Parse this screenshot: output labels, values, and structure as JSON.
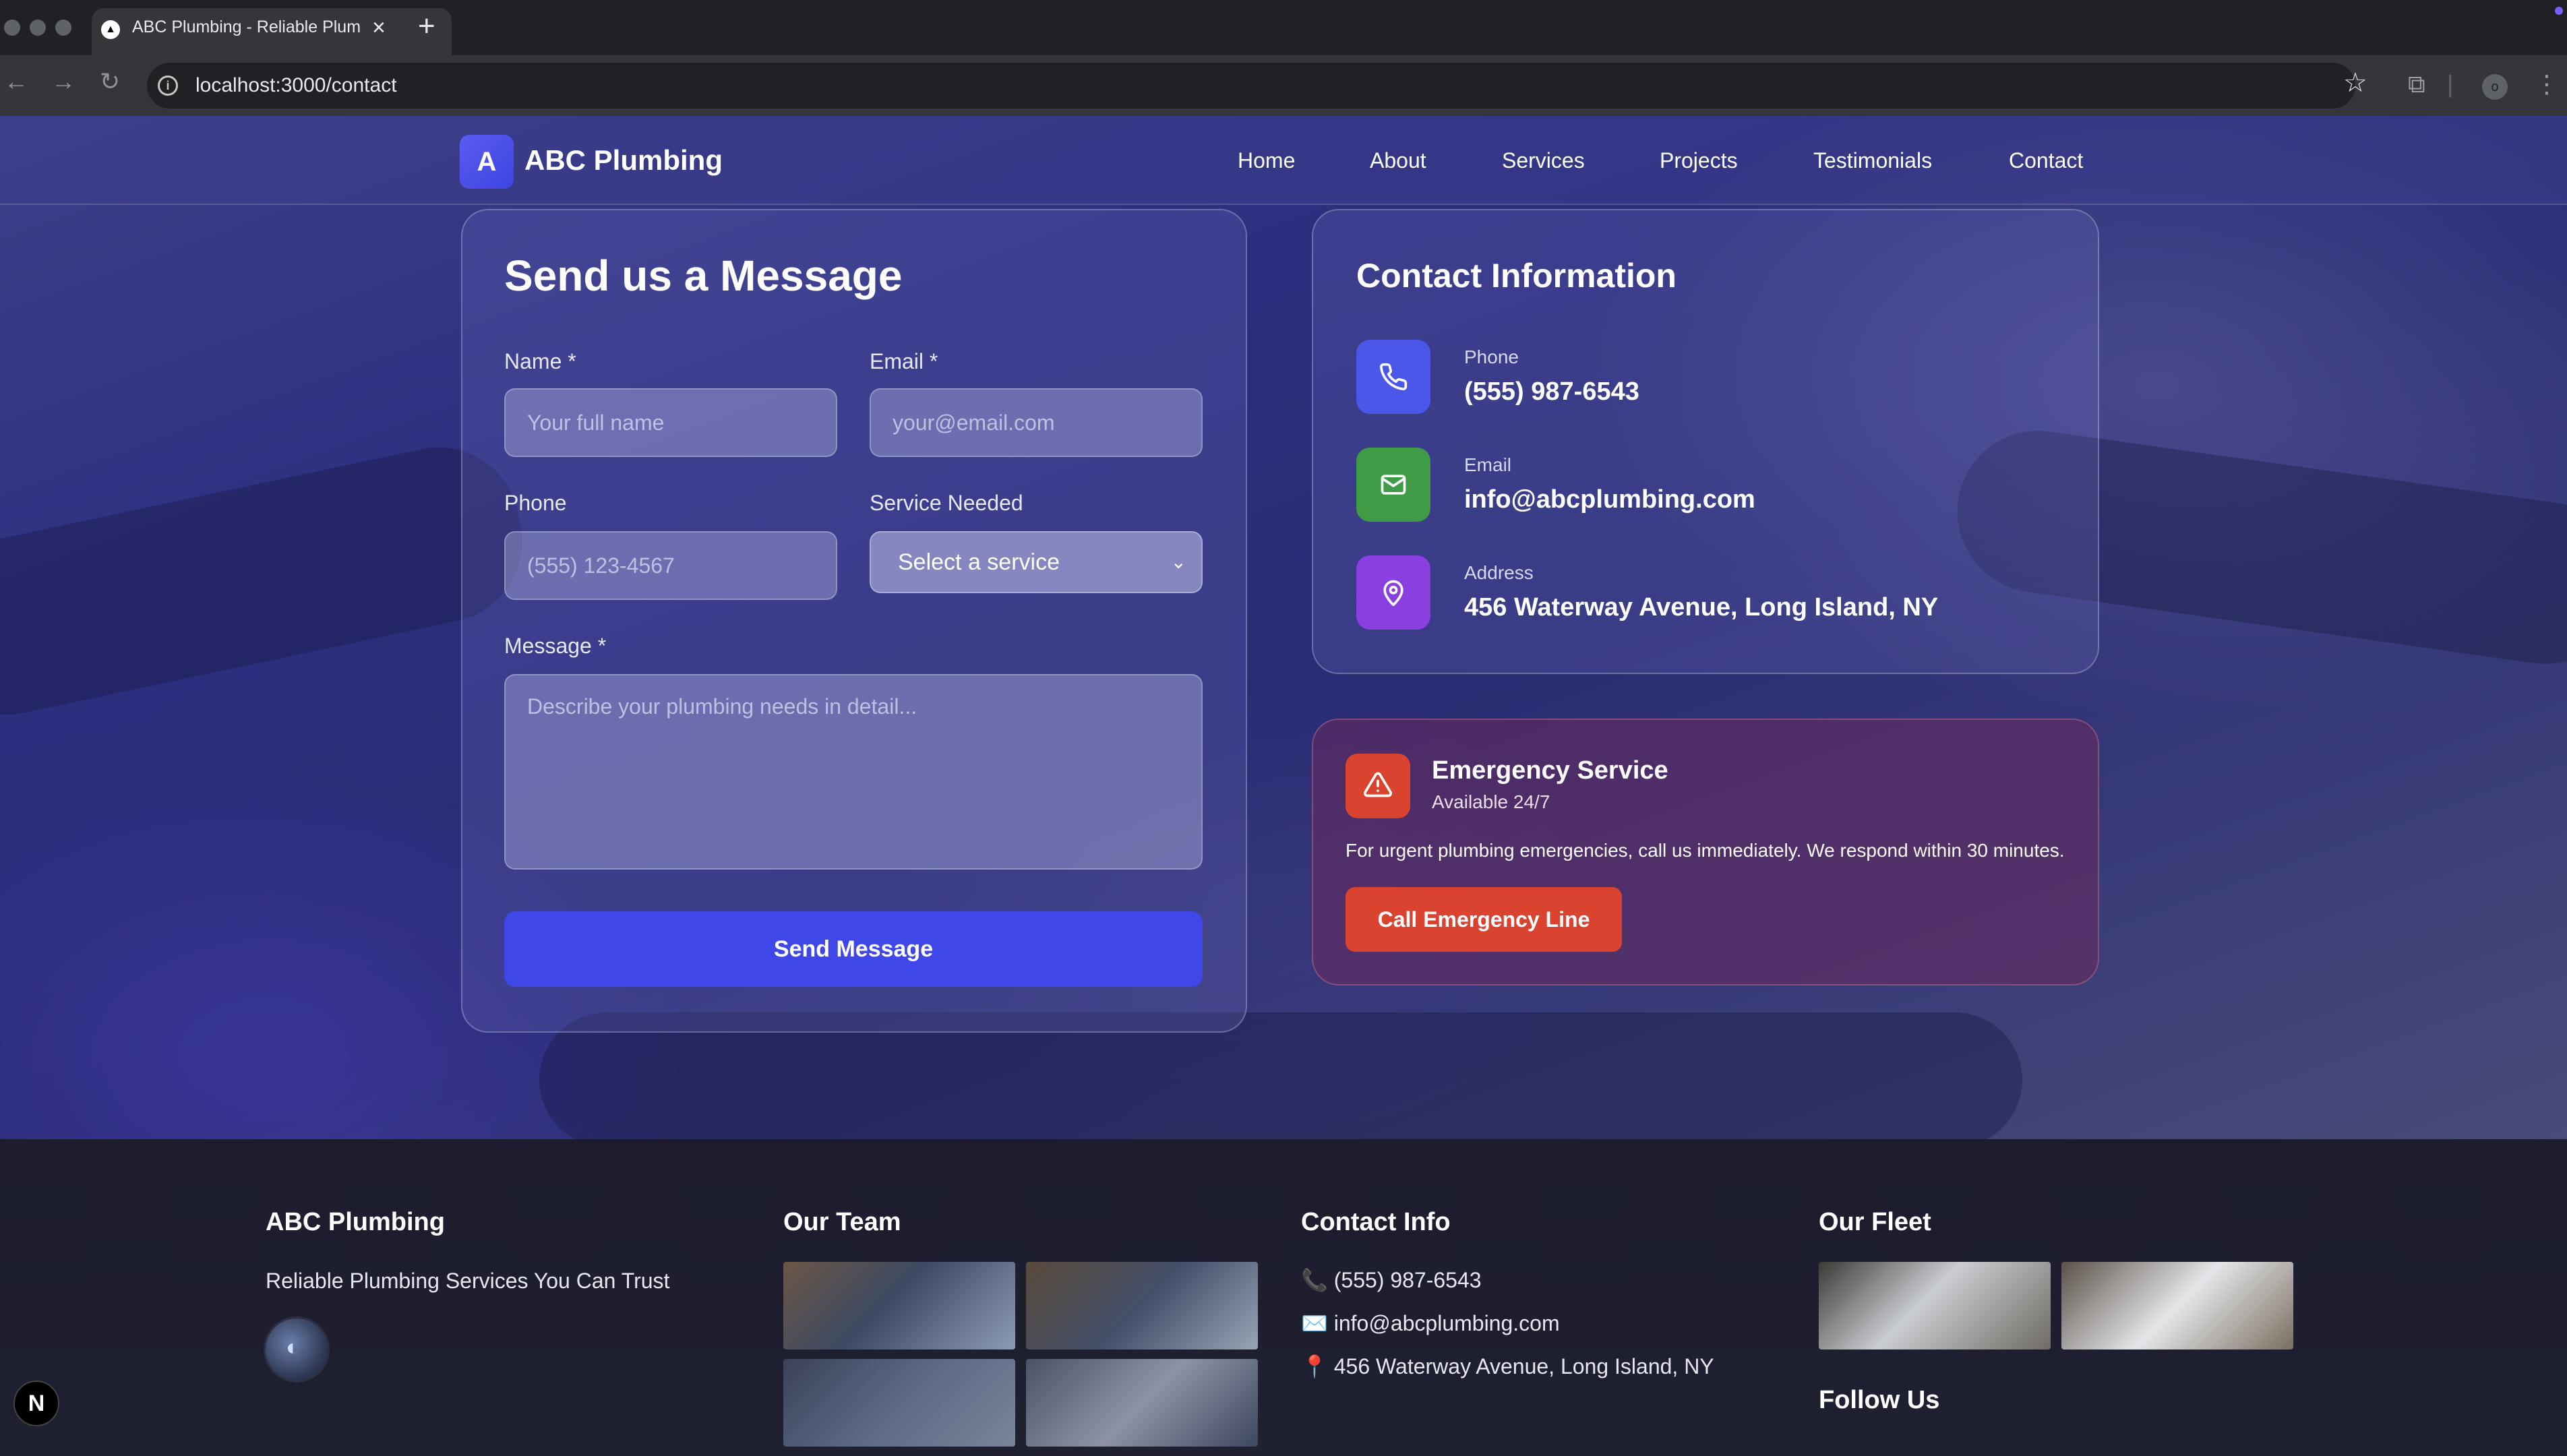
{
  "browser": {
    "tab_title": "ABC Plumbing - Reliable Plumbing Services",
    "url": "localhost:3000/contact"
  },
  "site": {
    "logo_letter": "A",
    "logo_text": "ABC Plumbing",
    "nav": [
      "Home",
      "About",
      "Services",
      "Projects",
      "Testimonials",
      "Contact"
    ]
  },
  "form": {
    "title": "Send us a Message",
    "name_label": "Name *",
    "name_placeholder": "Your full name",
    "email_label": "Email *",
    "email_placeholder": "your@email.com",
    "phone_label": "Phone",
    "phone_placeholder": "(555) 123-4567",
    "service_label": "Service Needed",
    "service_value": "Select a service",
    "message_label": "Message *",
    "message_placeholder": "Describe your plumbing needs in detail...",
    "submit_label": "Send Message"
  },
  "contact_info": {
    "title": "Contact Information",
    "phone_label": "Phone",
    "phone_value": "(555) 987-6543",
    "email_label": "Email",
    "email_value": "info@abcplumbing.com",
    "address_label": "Address",
    "address_value": "456 Waterway Avenue, Long Island, NY"
  },
  "emergency": {
    "title": "Emergency Service",
    "subtitle": "Available 24/7",
    "text": "For urgent plumbing emergencies, call us immediately. We respond within 30 minutes.",
    "button": "Call Emergency Line"
  },
  "footer": {
    "brand": "ABC Plumbing",
    "tagline": "Reliable Plumbing Services You Can Trust",
    "team_title": "Our Team",
    "contact_title": "Contact Info",
    "contact_phone": "📞 (555) 987-6543",
    "contact_email": "✉️ info@abcplumbing.com",
    "contact_address": "📍 456 Waterway Avenue, Long Island, NY",
    "fleet_title": "Our Fleet",
    "follow_title": "Follow Us"
  },
  "dev_badge": "N",
  "colors": {
    "primary": "#3f47e8",
    "phone_icon_bg": "#4b57e8",
    "email_icon_bg": "#3f9b45",
    "address_icon_bg": "#8a3fe0",
    "emergency": "#d9432f"
  }
}
